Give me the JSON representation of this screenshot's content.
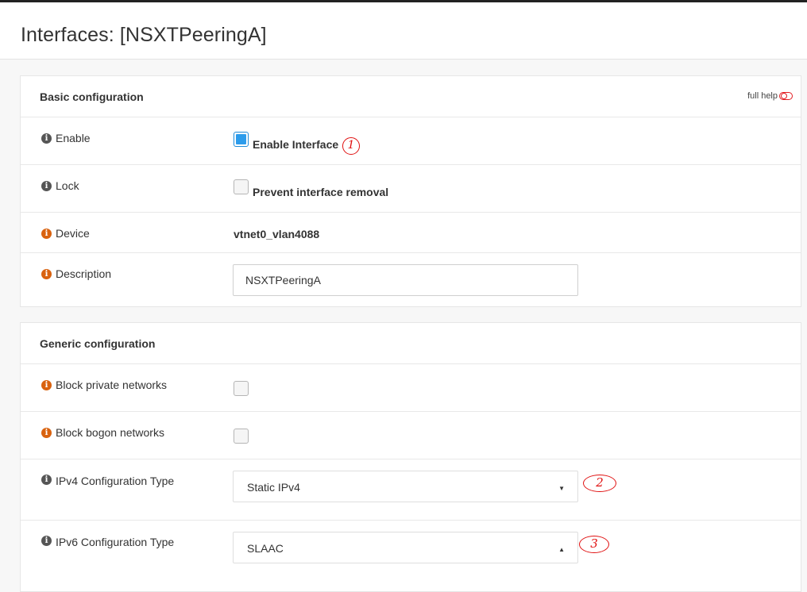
{
  "page": {
    "title": "Interfaces: [NSXTPeeringA]"
  },
  "basic": {
    "title": "Basic configuration",
    "full_help": "full help",
    "enable": {
      "label": "Enable",
      "checkbox_label": "Enable Interface",
      "checked": true
    },
    "lock": {
      "label": "Lock",
      "checkbox_label": "Prevent interface removal",
      "checked": false
    },
    "device": {
      "label": "Device",
      "value": "vtnet0_vlan4088"
    },
    "description": {
      "label": "Description",
      "value": "NSXTPeeringA"
    }
  },
  "generic": {
    "title": "Generic configuration",
    "block_private": {
      "label": "Block private networks",
      "checked": false
    },
    "block_bogon": {
      "label": "Block bogon networks",
      "checked": false
    },
    "ipv4": {
      "label": "IPv4 Configuration Type",
      "value": "Static IPv4",
      "caret": "▼"
    },
    "ipv6": {
      "label": "IPv6 Configuration Type",
      "value": "SLAAC",
      "caret": "▲"
    }
  },
  "annotations": [
    "1",
    "2",
    "3"
  ],
  "colors": {
    "accent": "#2d9ceb",
    "info_orange": "#d9620f",
    "annotation_red": "#e01010"
  },
  "icons": {
    "info": "info-circle-icon",
    "help_toggle": "toggle-off-icon"
  }
}
